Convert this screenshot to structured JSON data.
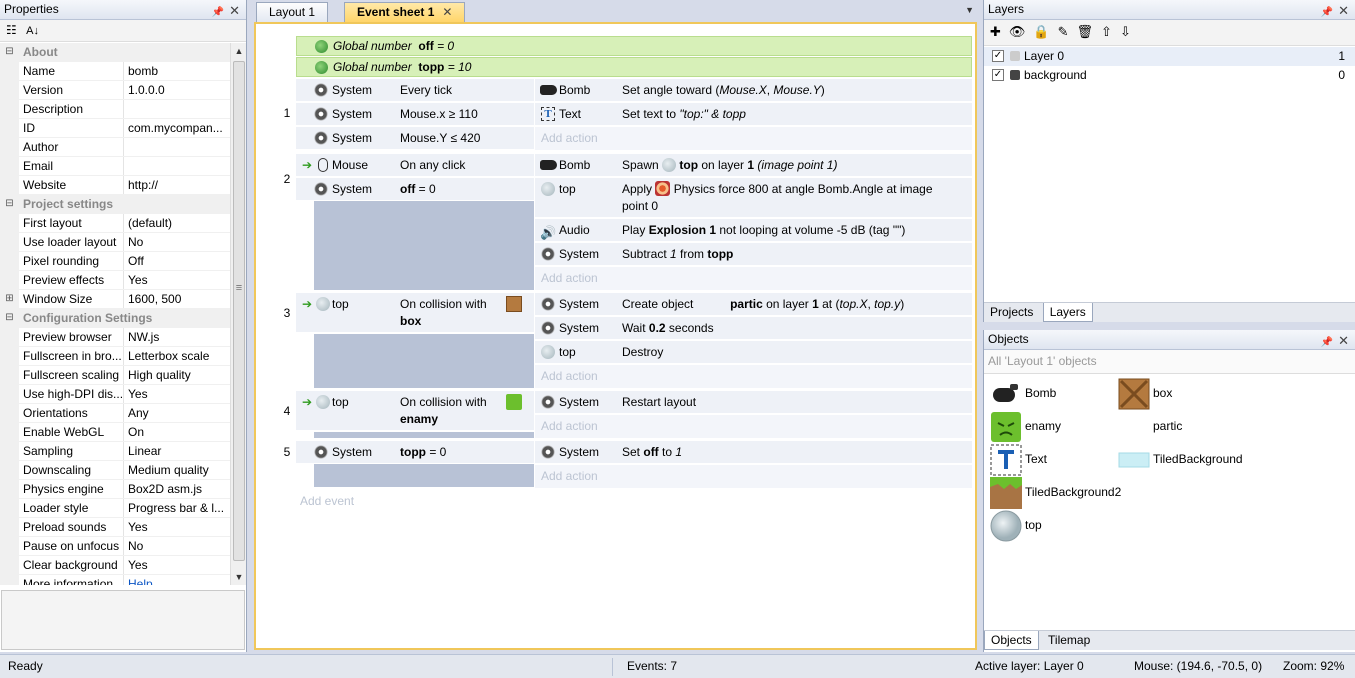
{
  "properties": {
    "title": "Properties",
    "rows": [
      {
        "type": "cat",
        "label": "About",
        "gut": "⊟"
      },
      {
        "key": "Name",
        "value": "bomb"
      },
      {
        "key": "Version",
        "value": "1.0.0.0"
      },
      {
        "key": "Description",
        "value": ""
      },
      {
        "key": "ID",
        "value": "com.mycompan..."
      },
      {
        "key": "Author",
        "value": ""
      },
      {
        "key": "Email",
        "value": ""
      },
      {
        "key": "Website",
        "value": "http://"
      },
      {
        "type": "cat",
        "label": "Project settings",
        "gut": "⊟"
      },
      {
        "key": "First layout",
        "value": "(default)"
      },
      {
        "key": "Use loader layout",
        "value": "No"
      },
      {
        "key": "Pixel rounding",
        "value": "Off"
      },
      {
        "key": "Preview effects",
        "value": "Yes"
      },
      {
        "key": "Window Size",
        "value": "1600, 500",
        "gut": "⊞"
      },
      {
        "type": "cat",
        "label": "Configuration Settings",
        "gut": "⊟"
      },
      {
        "key": "Preview browser",
        "value": "NW.js"
      },
      {
        "key": "Fullscreen in bro...",
        "value": "Letterbox scale"
      },
      {
        "key": "Fullscreen scaling",
        "value": "High quality"
      },
      {
        "key": "Use high-DPI dis...",
        "value": "Yes"
      },
      {
        "key": "Orientations",
        "value": "Any"
      },
      {
        "key": "Enable WebGL",
        "value": "On"
      },
      {
        "key": "Sampling",
        "value": "Linear"
      },
      {
        "key": "Downscaling",
        "value": "Medium quality"
      },
      {
        "key": "Physics engine",
        "value": "Box2D asm.js"
      },
      {
        "key": "Loader style",
        "value": "Progress bar & l..."
      },
      {
        "key": "Preload sounds",
        "value": "Yes"
      },
      {
        "key": "Pause on unfocus",
        "value": "No"
      },
      {
        "key": "Clear background",
        "value": "Yes"
      },
      {
        "key": "More information",
        "value": "Help",
        "link": true
      }
    ]
  },
  "tabs": [
    {
      "label": "Layout 1",
      "active": false
    },
    {
      "label": "Event sheet 1",
      "active": true,
      "close": "✕"
    }
  ],
  "globals": [
    {
      "prefix": "Global number",
      "name": "off",
      "rest": "= 0"
    },
    {
      "prefix": "Global number",
      "name": "topp",
      "rest": "= 10"
    }
  ],
  "events": {
    "e1": {
      "num": "1",
      "conds": [
        {
          "obj": "System",
          "text": "Every tick"
        },
        {
          "obj": "System",
          "text": "Mouse.x ≥ 110"
        },
        {
          "obj": "System",
          "text": "Mouse.Y ≤ 420"
        }
      ],
      "acts": [
        {
          "obj": "Bomb",
          "t1": "Set angle toward (",
          "i1": "Mouse.X",
          "t2": ", ",
          "i2": "Mouse.Y",
          "t3": ")"
        },
        {
          "obj": "Text",
          "t1": "Set text to ",
          "i1": "\"top:\" & topp"
        }
      ]
    },
    "e2": {
      "num": "2",
      "conds": [
        {
          "obj": "Mouse",
          "text": "On any click"
        },
        {
          "obj": "System",
          "b": "off",
          "text": " = 0"
        }
      ],
      "acts": [
        {
          "obj": "Bomb",
          "t1": "Spawn ",
          "b1": "top",
          "t2": " on layer ",
          "b2": "1",
          "t3": " ",
          "i1": "(image point 1)"
        },
        {
          "obj": "top",
          "t1": "Apply ",
          "t2": " Physics force 800 at angle Bomb.Angle at image",
          "t3": "point 0"
        },
        {
          "obj": "Audio",
          "t1": "Play ",
          "b1": "Explosion 1",
          "t2": " not looping at volume -5 dB (tag \"\")"
        },
        {
          "obj": "System",
          "t1": "Subtract ",
          "i1": "1",
          "t2": " from ",
          "b1": "topp"
        }
      ]
    },
    "e3": {
      "num": "3",
      "cond": {
        "obj": "top",
        "text": "On collision with",
        "b": "box"
      },
      "acts": [
        {
          "obj": "System",
          "t1": "Create object",
          "b1": "partic",
          "t2": " on layer ",
          "b2": "1",
          "t3": " at (",
          "i1": "top.X",
          "t4": ", ",
          "i2": "top.y",
          "t5": ")"
        },
        {
          "obj": "System",
          "t1": "Wait ",
          "b1": "0.2",
          "t2": " seconds"
        },
        {
          "obj": "top",
          "t1": "Destroy"
        }
      ]
    },
    "e4": {
      "num": "4",
      "cond": {
        "obj": "top",
        "text": "On collision with",
        "b": "enamy"
      },
      "acts": [
        {
          "obj": "System",
          "t1": "Restart layout"
        }
      ]
    },
    "e5": {
      "num": "5",
      "cond": {
        "obj": "System",
        "b": "topp",
        "text": " = 0"
      },
      "acts": [
        {
          "obj": "System",
          "t1": "Set ",
          "b1": "off",
          "t2": " to ",
          "i1": "1"
        }
      ]
    },
    "add_action": "Add action",
    "add_event": "Add event"
  },
  "layers": {
    "title": "Layers",
    "items": [
      {
        "name": "Layer 0",
        "num": "1",
        "check": "✓"
      },
      {
        "name": "background",
        "num": "0",
        "check": "✓"
      }
    ],
    "tabs": [
      "Projects",
      "Layers"
    ]
  },
  "objects": {
    "title": "Objects",
    "filter": "All 'Layout 1' objects",
    "items": [
      "Bomb",
      "box",
      "enamy",
      "partic",
      "Text",
      "TiledBackground",
      "TiledBackground2",
      "top"
    ],
    "tabs": [
      "Objects",
      "Tilemap"
    ],
    "text_glyph": "T"
  },
  "status": {
    "ready": "Ready",
    "events": "Events: 7",
    "active_layer": "Active layer: Layer 0",
    "mouse": "Mouse: (194.6, -70.5, 0)",
    "zoom": "Zoom: 92%"
  },
  "icons": {
    "pin": "📌",
    "close": "✕",
    "menu": "▼",
    "arrow": "➔",
    "audio": "🔊",
    "sort_cat": "☷",
    "sort_az": "A↓",
    "scroll_up": "▲",
    "scroll_down": "▼",
    "grip": "≡",
    "add": "✚",
    "eye": "👁",
    "lock": "🔒",
    "pencil": "✎",
    "trash": "🗑",
    "up": "⇧",
    "down": "⇩"
  }
}
